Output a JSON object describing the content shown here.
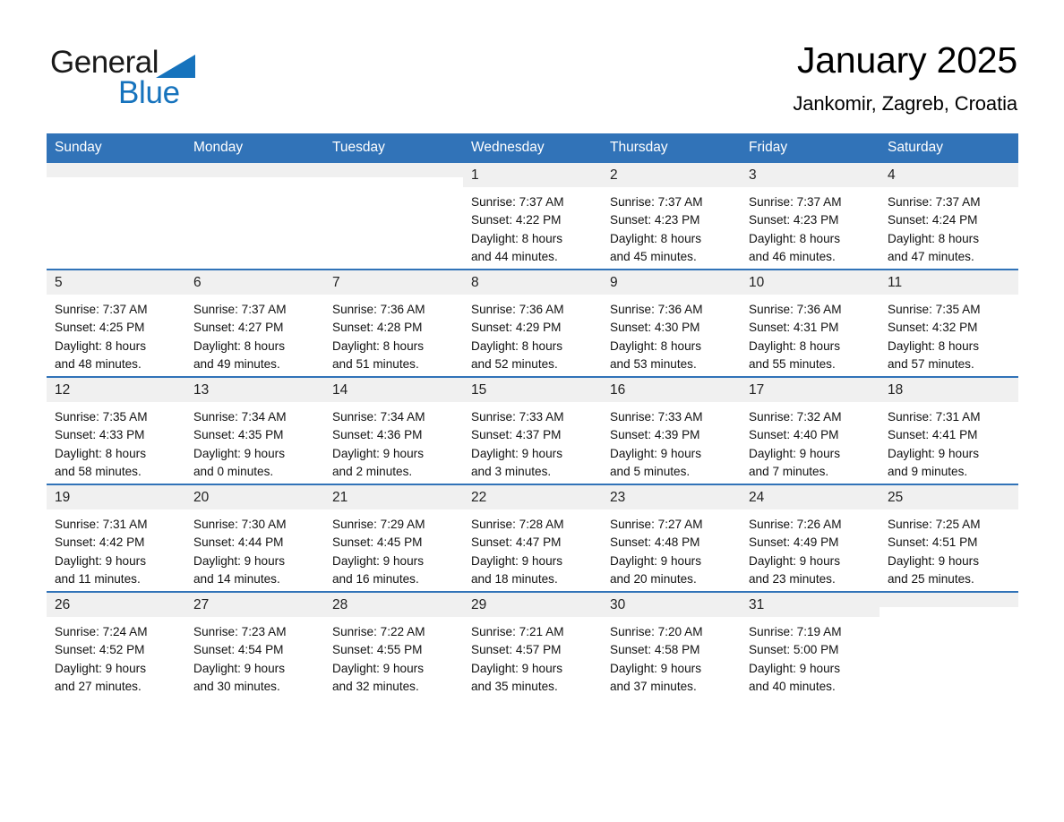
{
  "brand": {
    "name_part1": "General",
    "name_part2": "Blue",
    "triangle_color": "#1673bd",
    "logo_icon": "blue-triangle-icon"
  },
  "header": {
    "month_title": "January 2025",
    "location": "Jankomir, Zagreb, Croatia"
  },
  "colors": {
    "header_blue": "#3173b8",
    "daynum_gray": "#f0f0f0",
    "text": "#111111",
    "header_text": "#ffffff"
  },
  "weekday_headers": [
    "Sunday",
    "Monday",
    "Tuesday",
    "Wednesday",
    "Thursday",
    "Friday",
    "Saturday"
  ],
  "weeks": [
    [
      {
        "day": "",
        "info": ""
      },
      {
        "day": "",
        "info": ""
      },
      {
        "day": "",
        "info": ""
      },
      {
        "day": "1",
        "info": "Sunrise: 7:37 AM\nSunset: 4:22 PM\nDaylight: 8 hours\nand 44 minutes."
      },
      {
        "day": "2",
        "info": "Sunrise: 7:37 AM\nSunset: 4:23 PM\nDaylight: 8 hours\nand 45 minutes."
      },
      {
        "day": "3",
        "info": "Sunrise: 7:37 AM\nSunset: 4:23 PM\nDaylight: 8 hours\nand 46 minutes."
      },
      {
        "day": "4",
        "info": "Sunrise: 7:37 AM\nSunset: 4:24 PM\nDaylight: 8 hours\nand 47 minutes."
      }
    ],
    [
      {
        "day": "5",
        "info": "Sunrise: 7:37 AM\nSunset: 4:25 PM\nDaylight: 8 hours\nand 48 minutes."
      },
      {
        "day": "6",
        "info": "Sunrise: 7:37 AM\nSunset: 4:27 PM\nDaylight: 8 hours\nand 49 minutes."
      },
      {
        "day": "7",
        "info": "Sunrise: 7:36 AM\nSunset: 4:28 PM\nDaylight: 8 hours\nand 51 minutes."
      },
      {
        "day": "8",
        "info": "Sunrise: 7:36 AM\nSunset: 4:29 PM\nDaylight: 8 hours\nand 52 minutes."
      },
      {
        "day": "9",
        "info": "Sunrise: 7:36 AM\nSunset: 4:30 PM\nDaylight: 8 hours\nand 53 minutes."
      },
      {
        "day": "10",
        "info": "Sunrise: 7:36 AM\nSunset: 4:31 PM\nDaylight: 8 hours\nand 55 minutes."
      },
      {
        "day": "11",
        "info": "Sunrise: 7:35 AM\nSunset: 4:32 PM\nDaylight: 8 hours\nand 57 minutes."
      }
    ],
    [
      {
        "day": "12",
        "info": "Sunrise: 7:35 AM\nSunset: 4:33 PM\nDaylight: 8 hours\nand 58 minutes."
      },
      {
        "day": "13",
        "info": "Sunrise: 7:34 AM\nSunset: 4:35 PM\nDaylight: 9 hours\nand 0 minutes."
      },
      {
        "day": "14",
        "info": "Sunrise: 7:34 AM\nSunset: 4:36 PM\nDaylight: 9 hours\nand 2 minutes."
      },
      {
        "day": "15",
        "info": "Sunrise: 7:33 AM\nSunset: 4:37 PM\nDaylight: 9 hours\nand 3 minutes."
      },
      {
        "day": "16",
        "info": "Sunrise: 7:33 AM\nSunset: 4:39 PM\nDaylight: 9 hours\nand 5 minutes."
      },
      {
        "day": "17",
        "info": "Sunrise: 7:32 AM\nSunset: 4:40 PM\nDaylight: 9 hours\nand 7 minutes."
      },
      {
        "day": "18",
        "info": "Sunrise: 7:31 AM\nSunset: 4:41 PM\nDaylight: 9 hours\nand 9 minutes."
      }
    ],
    [
      {
        "day": "19",
        "info": "Sunrise: 7:31 AM\nSunset: 4:42 PM\nDaylight: 9 hours\nand 11 minutes."
      },
      {
        "day": "20",
        "info": "Sunrise: 7:30 AM\nSunset: 4:44 PM\nDaylight: 9 hours\nand 14 minutes."
      },
      {
        "day": "21",
        "info": "Sunrise: 7:29 AM\nSunset: 4:45 PM\nDaylight: 9 hours\nand 16 minutes."
      },
      {
        "day": "22",
        "info": "Sunrise: 7:28 AM\nSunset: 4:47 PM\nDaylight: 9 hours\nand 18 minutes."
      },
      {
        "day": "23",
        "info": "Sunrise: 7:27 AM\nSunset: 4:48 PM\nDaylight: 9 hours\nand 20 minutes."
      },
      {
        "day": "24",
        "info": "Sunrise: 7:26 AM\nSunset: 4:49 PM\nDaylight: 9 hours\nand 23 minutes."
      },
      {
        "day": "25",
        "info": "Sunrise: 7:25 AM\nSunset: 4:51 PM\nDaylight: 9 hours\nand 25 minutes."
      }
    ],
    [
      {
        "day": "26",
        "info": "Sunrise: 7:24 AM\nSunset: 4:52 PM\nDaylight: 9 hours\nand 27 minutes."
      },
      {
        "day": "27",
        "info": "Sunrise: 7:23 AM\nSunset: 4:54 PM\nDaylight: 9 hours\nand 30 minutes."
      },
      {
        "day": "28",
        "info": "Sunrise: 7:22 AM\nSunset: 4:55 PM\nDaylight: 9 hours\nand 32 minutes."
      },
      {
        "day": "29",
        "info": "Sunrise: 7:21 AM\nSunset: 4:57 PM\nDaylight: 9 hours\nand 35 minutes."
      },
      {
        "day": "30",
        "info": "Sunrise: 7:20 AM\nSunset: 4:58 PM\nDaylight: 9 hours\nand 37 minutes."
      },
      {
        "day": "31",
        "info": "Sunrise: 7:19 AM\nSunset: 5:00 PM\nDaylight: 9 hours\nand 40 minutes."
      },
      {
        "day": "",
        "info": ""
      }
    ]
  ]
}
